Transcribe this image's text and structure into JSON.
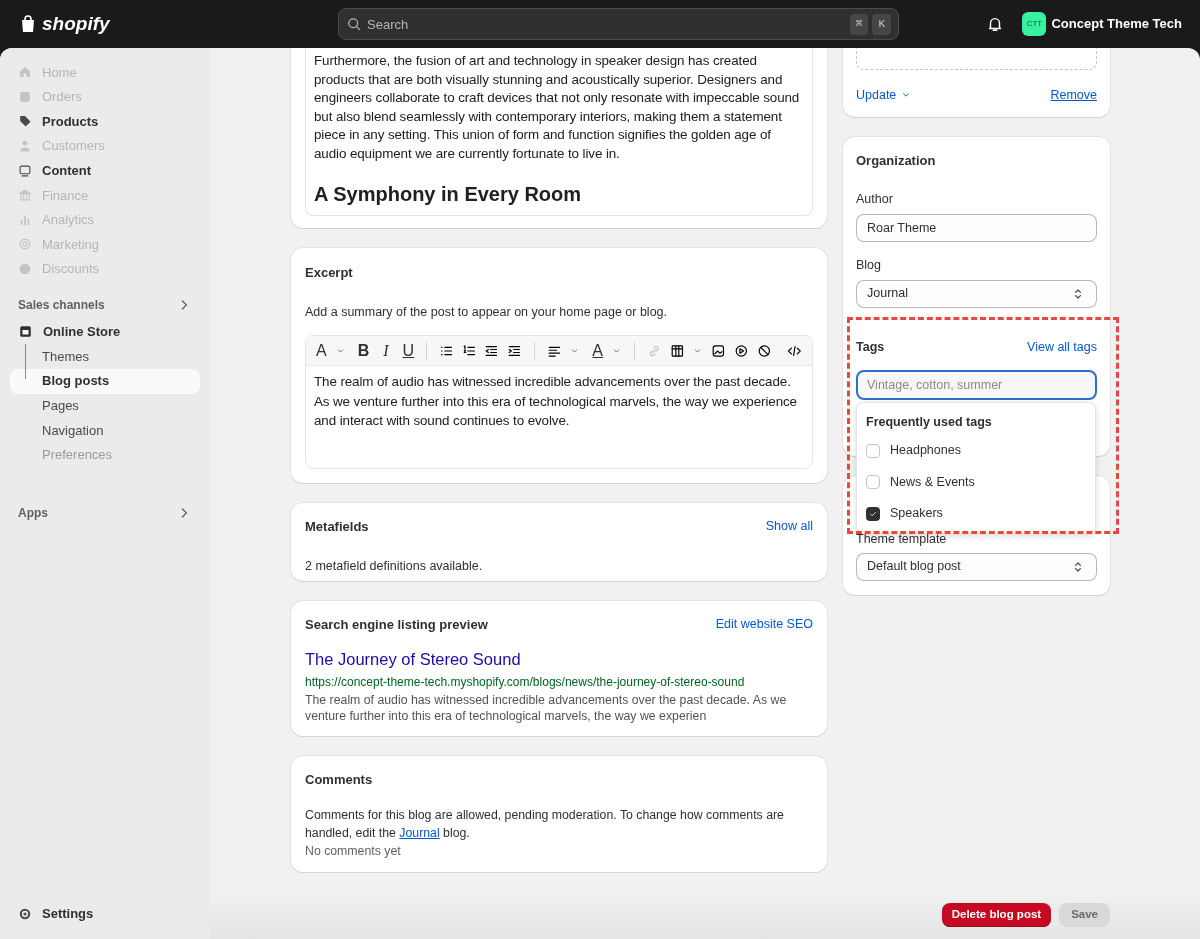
{
  "topbar": {
    "logo": "shopify",
    "search": {
      "placeholder": "Search"
    },
    "shortcut": [
      "⌘",
      "K"
    ],
    "store": {
      "initials": "CTT",
      "name": "Concept Theme Tech"
    }
  },
  "sidebar": {
    "items": [
      {
        "label": "Home",
        "disabled": true
      },
      {
        "label": "Orders",
        "disabled": true
      },
      {
        "label": "Products",
        "disabled": false
      },
      {
        "label": "Customers",
        "disabled": true
      },
      {
        "label": "Content",
        "disabled": false
      },
      {
        "label": "Finance",
        "disabled": true
      },
      {
        "label": "Analytics",
        "disabled": true
      },
      {
        "label": "Marketing",
        "disabled": true
      },
      {
        "label": "Discounts",
        "disabled": true
      }
    ],
    "sales_channels": "Sales channels",
    "online_store": {
      "label": "Online Store",
      "children": [
        {
          "label": "Themes",
          "selected": false,
          "disabled": false
        },
        {
          "label": "Blog posts",
          "selected": true,
          "disabled": false
        },
        {
          "label": "Pages",
          "selected": false,
          "disabled": false
        },
        {
          "label": "Navigation",
          "selected": false,
          "disabled": false
        },
        {
          "label": "Preferences",
          "selected": false,
          "disabled": true
        }
      ]
    },
    "apps": "Apps",
    "settings": "Settings"
  },
  "content_card": {
    "paragraph": "Furthermore, the fusion of art and technology in speaker design has created products that are both visually stunning and acoustically superior. Designers and engineers collaborate to craft devices that not only resonate with impeccable sound but also blend seamlessly with contemporary interiors, making them a statement piece in any setting. This union of form and function signifies the golden age of audio equipment we are currently fortunate to live in.",
    "heading": "A Symphony in Every Room"
  },
  "excerpt": {
    "title": "Excerpt",
    "hint": "Add a summary of the post to appear on your home page or blog.",
    "toolbar": {
      "font": "A",
      "bold": "B",
      "italic": "I",
      "underline": "U",
      "text_color": "A"
    },
    "text": "The realm of audio has witnessed incredible advancements over the past decade. As we venture further into this era of technological marvels, the way we experience and interact with sound continues to evolve."
  },
  "metafields": {
    "title": "Metafields",
    "link": "Show all",
    "text": "2 metafield definitions available."
  },
  "seo": {
    "title": "Search engine listing preview",
    "link": "Edit website SEO",
    "page_title": "The Journey of Stereo Sound",
    "url": "https://concept-theme-tech.myshopify.com/blogs/news/the-journey-of-stereo-sound",
    "description": "The realm of audio has witnessed incredible advancements over the past decade. As we venture further into this era of technological marvels, the way we experien"
  },
  "comments": {
    "title": "Comments",
    "text_before": "Comments for this blog are allowed, pending moderation. To change how comments are handled, edit the ",
    "link": "Journal",
    "text_after": " blog.",
    "empty": "No comments yet"
  },
  "image_card": {
    "update": "Update",
    "remove": "Remove"
  },
  "organization": {
    "title": "Organization",
    "author_label": "Author",
    "author": "Roar Theme",
    "blog_label": "Blog",
    "blog": "Journal",
    "tags_label": "Tags",
    "tags_link": "View all tags",
    "tags_placeholder": "Vintage, cotton, summer"
  },
  "tags_dropdown": {
    "title": "Frequently used tags",
    "options": [
      {
        "label": "Headphones",
        "checked": false
      },
      {
        "label": "News & Events",
        "checked": false
      },
      {
        "label": "Speakers",
        "checked": true
      }
    ]
  },
  "template": {
    "label": "Theme template",
    "value": "Default blog post"
  },
  "actions": {
    "delete": "Delete blog post",
    "save": "Save",
    "save_disabled": true
  }
}
